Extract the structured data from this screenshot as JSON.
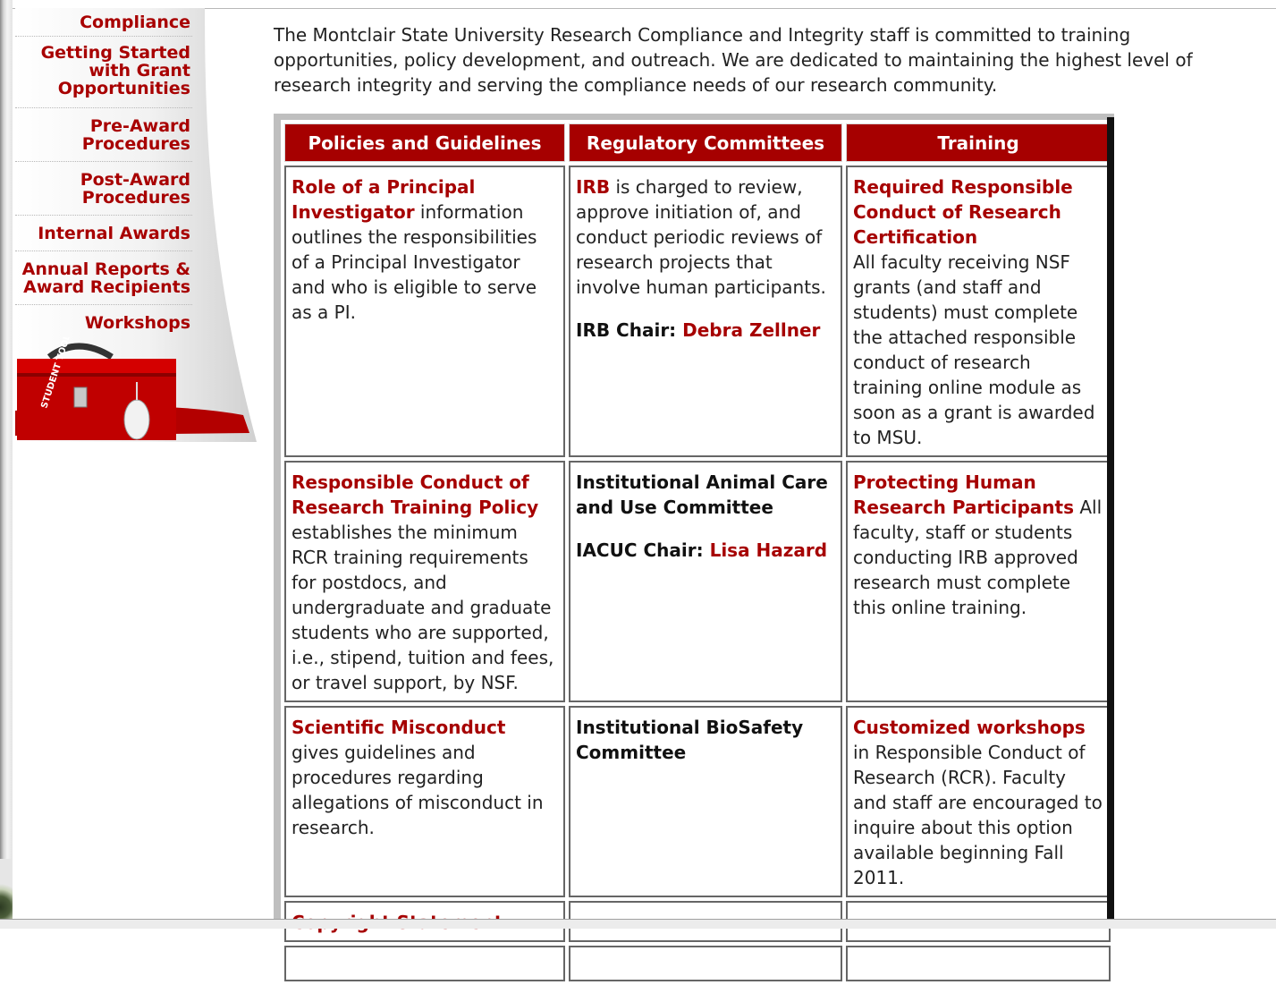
{
  "sidebar": {
    "items": [
      {
        "label": "Compliance"
      },
      {
        "label": "Getting Started with Grant Opportunities"
      },
      {
        "label": "Pre-Award Procedures"
      },
      {
        "label": "Post-Award Procedures"
      },
      {
        "label": "Internal Awards"
      },
      {
        "label": "Annual Reports & Award Recipients"
      },
      {
        "label": "Workshops"
      }
    ],
    "toolbox_text": "STUDENT TOOLBOX"
  },
  "intro": "The Montclair State University Research Compliance and Integrity staff is committed to training opportunities, policy development, and outreach. We are dedicated to maintaining the highest level of research integrity and serving the compliance needs of our research community.",
  "table": {
    "headers": [
      "Policies and Guidelines",
      "Regulatory Committees",
      "Training"
    ],
    "row1": {
      "c1_link": "Role of a Principal Investigator",
      "c1_text": " information outlines the responsibilities of a Principal Investigator and who is eligible to serve as a PI.",
      "c2_link": "IRB",
      "c2_text": " is charged to review, approve initiation of, and conduct periodic reviews of research projects that involve human participants.",
      "c2_chair_label": "IRB Chair: ",
      "c2_chair_name": "Debra Zellner",
      "c3_link": "Required Responsible Conduct of Research Certification",
      "c3_text": "All faculty receiving NSF grants (and staff and students) must complete the attached responsible conduct of research training online module as soon as a grant is awarded to MSU."
    },
    "row2": {
      "c1_link": "Responsible Conduct of Research Training Policy",
      "c1_text": "establishes the minimum RCR training requirements for postdocs, and undergraduate and graduate students who are supported, i.e., stipend, tuition and fees, or travel support, by NSF.",
      "c2_label": "Institutional Animal Care and Use Committee",
      "c2_chair_label": "IACUC Chair: ",
      "c2_chair_name": "Lisa Hazard",
      "c3_link": "Protecting Human Research Participants",
      "c3_text": " All faculty, staff or students conducting IRB approved research must complete this online training."
    },
    "row3": {
      "c1_link": "Scientific Misconduct",
      "c1_text": " gives guidelines and procedures regarding allegations of misconduct in research.",
      "c2_label": "Institutional BioSafety Committee",
      "c3_link": "Customized workshops",
      "c3_text": " in Responsible Conduct of Research (RCR). Faculty and staff are encouraged to inquire about this option available beginning Fall 2011."
    },
    "row4": {
      "c1_link": "Copyright Statement"
    }
  },
  "colors": {
    "accent": "#a60000",
    "text": "#222222",
    "table_border": "#666666"
  }
}
